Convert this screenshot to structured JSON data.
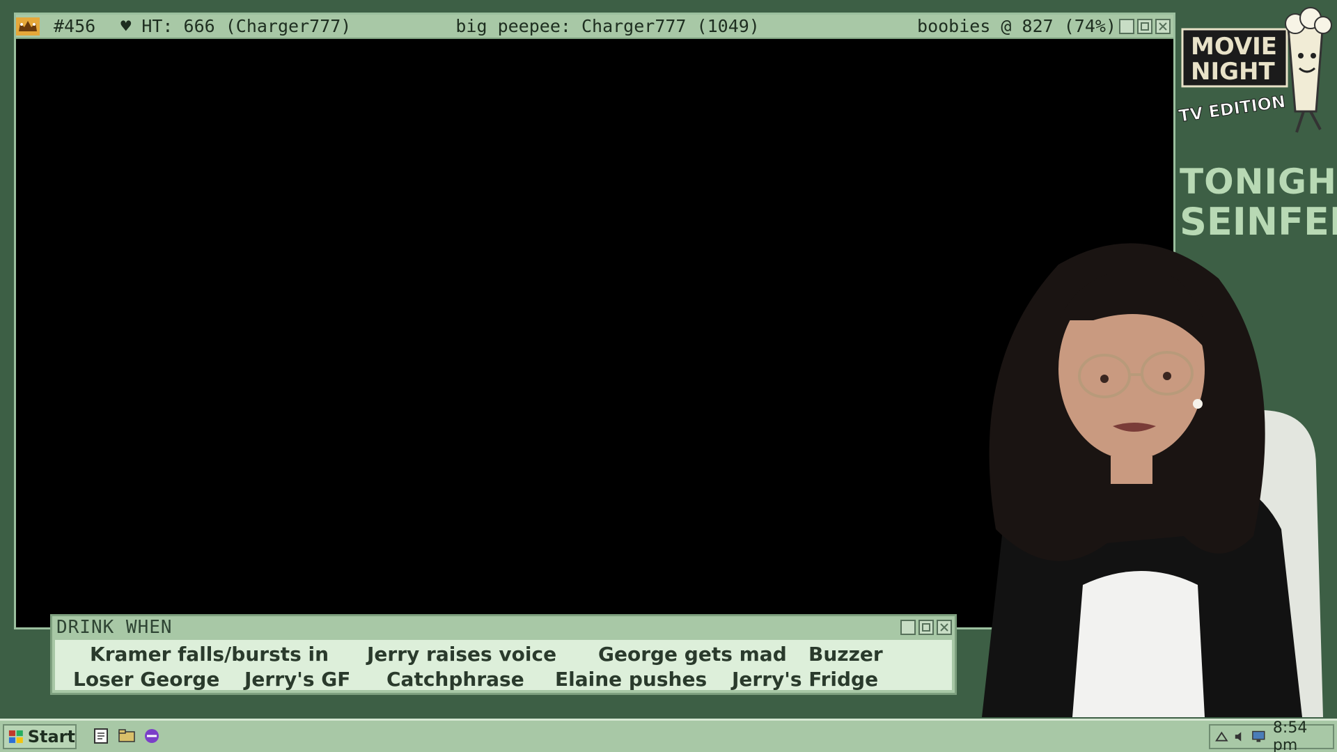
{
  "main_window": {
    "stream_id": "#456",
    "hp_label": "♥ HT: 666 (Charger777)",
    "big_label": "big peepee: Charger777 (1049)",
    "boobies_label": "boobies @ 827 (74%)"
  },
  "drink_window": {
    "title": "DRINK WHEN",
    "items": [
      "Kramer falls/bursts in",
      "Jerry raises voice",
      "George gets mad",
      "Buzzer",
      "Loser George",
      "Jerry's GF",
      "Catchphrase",
      "Elaine pushes",
      "Jerry's Fridge"
    ]
  },
  "overlay": {
    "logo_line1": "MOVIE",
    "logo_line2": "NIGHT",
    "logo_line3": "TV EDITION",
    "tonight_label": "TONIGHT:",
    "show_name": "SEINFELD"
  },
  "taskbar": {
    "start_label": "Start",
    "clock": "8:54 pm"
  },
  "colors": {
    "background": "#3d5f45",
    "window_chrome": "#a8c8a6",
    "drink_body": "#ddefda",
    "text_dark": "#1e2e20",
    "accent_light": "#b8d9b4"
  }
}
